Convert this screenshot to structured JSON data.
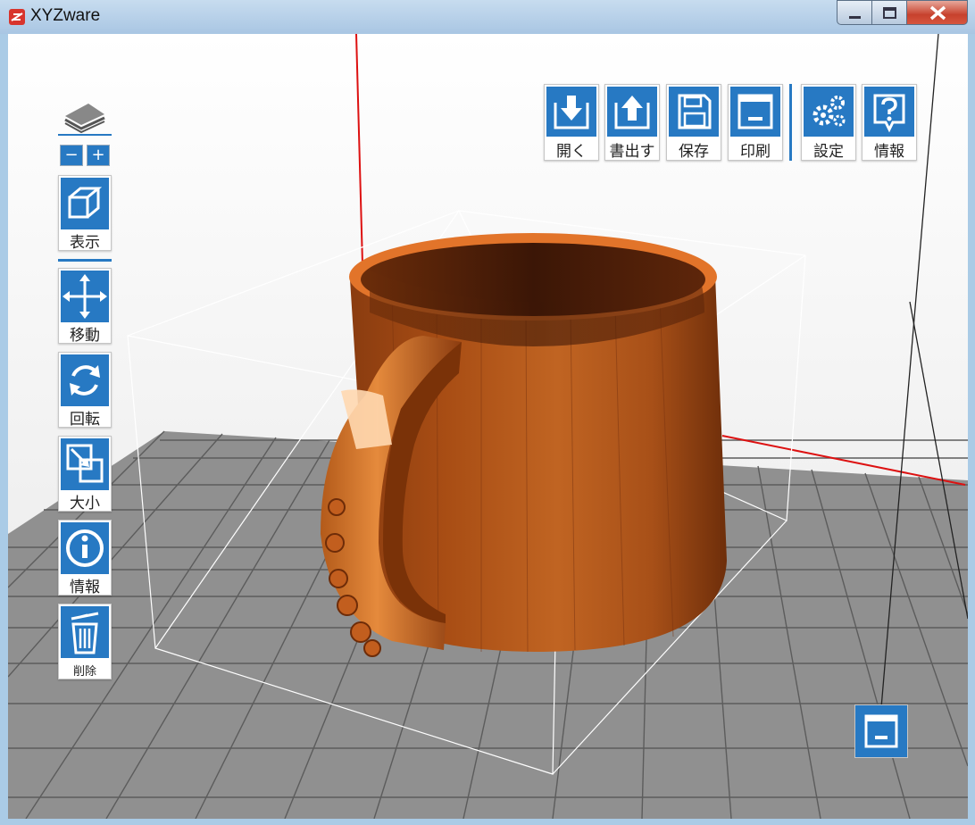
{
  "window": {
    "title": "XYZware",
    "controls": [
      "minimize",
      "maximize",
      "close"
    ]
  },
  "toolbar_top": {
    "buttons": [
      {
        "label": "開く",
        "icon": "open-icon"
      },
      {
        "label": "書出す",
        "icon": "export-icon"
      },
      {
        "label": "保存",
        "icon": "save-icon"
      },
      {
        "label": "印刷",
        "icon": "print-icon"
      },
      {
        "label": "設定",
        "icon": "settings-icon"
      },
      {
        "label": "情報",
        "icon": "help-icon"
      }
    ]
  },
  "toolbar_left": {
    "view_label": "表示",
    "move_label": "移動",
    "rotate_label": "回転",
    "scale_label": "大小",
    "info_label": "情報",
    "delete_label": "削除",
    "zoom_out": "−",
    "zoom_in": "+"
  },
  "colors": {
    "accent": "#2779c3",
    "model": "#c0601c",
    "grid": "#8a8a8a"
  }
}
